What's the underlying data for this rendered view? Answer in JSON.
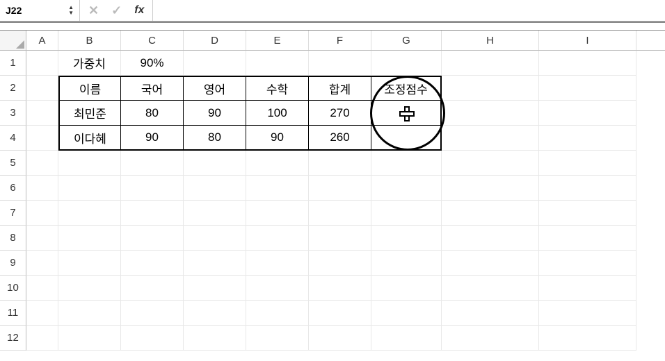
{
  "formula_bar": {
    "cell_ref": "J22",
    "fx_label": "fx",
    "formula_value": ""
  },
  "columns": [
    "A",
    "B",
    "C",
    "D",
    "E",
    "F",
    "G",
    "H",
    "I"
  ],
  "rows": [
    "1",
    "2",
    "3",
    "4",
    "5",
    "6",
    "7",
    "8",
    "9",
    "10",
    "11",
    "12"
  ],
  "cells": {
    "B1": "가중치",
    "C1": "90%",
    "B2": "이름",
    "C2": "국어",
    "D2": "영어",
    "E2": "수학",
    "F2": "합계",
    "G2": "조정점수",
    "B3": "최민준",
    "C3": "80",
    "D3": "90",
    "E3": "100",
    "F3": "270",
    "G3": "",
    "B4": "이다혜",
    "C4": "90",
    "D4": "80",
    "E4": "90",
    "F4": "260",
    "G4": ""
  },
  "chart_data": {
    "type": "table",
    "title": "",
    "weight_label": "가중치",
    "weight_value": "90%",
    "headers": [
      "이름",
      "국어",
      "영어",
      "수학",
      "합계",
      "조정점수"
    ],
    "rows": [
      {
        "이름": "최민준",
        "국어": 80,
        "영어": 90,
        "수학": 100,
        "합계": 270,
        "조정점수": null
      },
      {
        "이름": "이다혜",
        "국어": 90,
        "영어": 80,
        "수학": 90,
        "합계": 260,
        "조정점수": null
      }
    ]
  }
}
